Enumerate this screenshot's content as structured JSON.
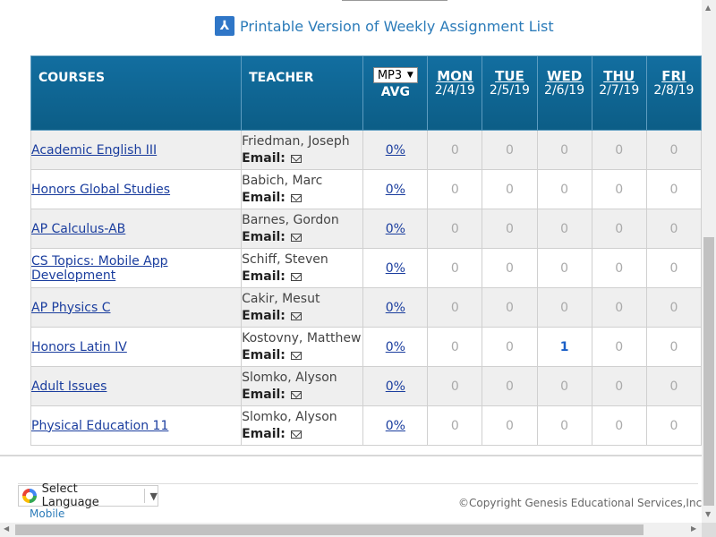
{
  "printable_link": "Printable Version of Weekly Assignment List",
  "table": {
    "headers": {
      "courses": "COURSES",
      "teacher": "TEACHER",
      "mp_selected": "MP3",
      "avg": "AVG"
    },
    "days": [
      {
        "name": "MON",
        "date": "2/4/19"
      },
      {
        "name": "TUE",
        "date": "2/5/19"
      },
      {
        "name": "WED",
        "date": "2/6/19"
      },
      {
        "name": "THU",
        "date": "2/7/19"
      },
      {
        "name": "FRI",
        "date": "2/8/19"
      }
    ],
    "email_label": "Email:",
    "rows": [
      {
        "course": "Academic English III",
        "teacher": "Friedman, Joseph",
        "avg": "0%",
        "counts": [
          "0",
          "0",
          "0",
          "0",
          "0"
        ]
      },
      {
        "course": "Honors Global Studies",
        "teacher": "Babich, Marc",
        "avg": "0%",
        "counts": [
          "0",
          "0",
          "0",
          "0",
          "0"
        ]
      },
      {
        "course": "AP Calculus-AB",
        "teacher": "Barnes, Gordon",
        "avg": "0%",
        "counts": [
          "0",
          "0",
          "0",
          "0",
          "0"
        ]
      },
      {
        "course": "CS Topics: Mobile App Development",
        "teacher": "Schiff, Steven",
        "avg": "0%",
        "counts": [
          "0",
          "0",
          "0",
          "0",
          "0"
        ]
      },
      {
        "course": "AP Physics C",
        "teacher": "Cakir, Mesut",
        "avg": "0%",
        "counts": [
          "0",
          "0",
          "0",
          "0",
          "0"
        ]
      },
      {
        "course": "Honors Latin IV",
        "teacher": "Kostovny, Matthew",
        "avg": "0%",
        "counts": [
          "0",
          "0",
          "1",
          "0",
          "0"
        ]
      },
      {
        "course": "Adult Issues",
        "teacher": "Slomko, Alyson",
        "avg": "0%",
        "counts": [
          "0",
          "0",
          "0",
          "0",
          "0"
        ]
      },
      {
        "course": "Physical Education 11",
        "teacher": "Slomko, Alyson",
        "avg": "0%",
        "counts": [
          "0",
          "0",
          "0",
          "0",
          "0"
        ]
      }
    ]
  },
  "footer": {
    "select_language": "Select Language",
    "mobile": "Mobile",
    "copyright": "©Copyright Genesis Educational Services,Inc."
  },
  "icons": {
    "pdf": "pdf-icon",
    "mail": "mail-icon",
    "google": "google-icon",
    "dropdown": "dropdown-arrow-icon"
  },
  "colors": {
    "header_bg": "#0f6793",
    "link": "#1a3d9e",
    "accent_link": "#2b7bb9",
    "highlight_count": "#1a5fc7"
  }
}
